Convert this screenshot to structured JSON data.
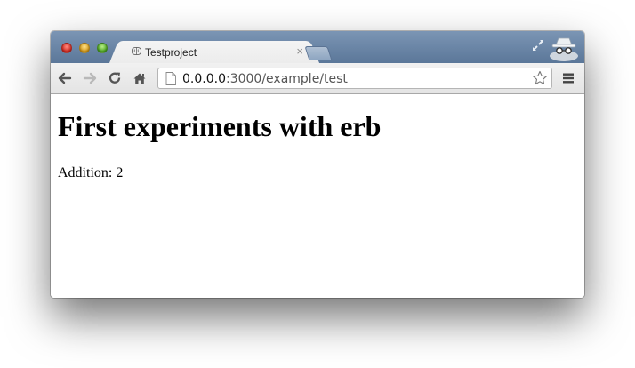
{
  "browser": {
    "tab": {
      "title": "Testproject",
      "close_label": "×"
    },
    "address_bar": {
      "host": "0.0.0.0",
      "rest": ":3000/example/test"
    },
    "icons": [
      "back-arrow-icon",
      "forward-arrow-icon",
      "reload-icon",
      "home-icon",
      "page-icon",
      "star-icon",
      "menu-icon",
      "fullscreen-icon",
      "incognito-icon"
    ]
  },
  "page": {
    "heading": "First experiments with erb",
    "addition_label": "Addition:",
    "addition_value": "2"
  }
}
